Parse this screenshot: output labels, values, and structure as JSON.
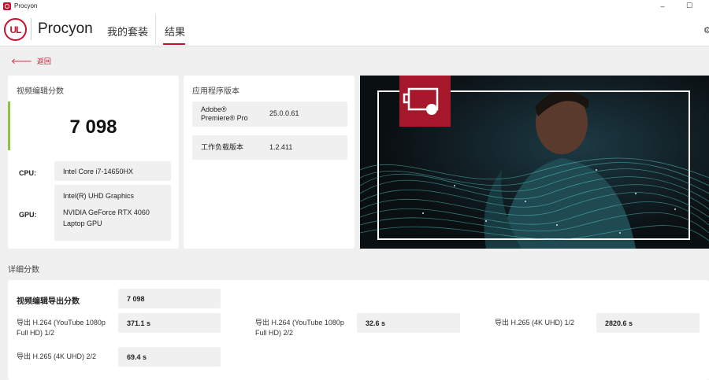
{
  "window": {
    "title": "Procyon",
    "minimize": "–",
    "maximize": "☐"
  },
  "header": {
    "logo_text": "UL",
    "brand": "Procyon",
    "tabs": [
      {
        "label": "我的套装"
      },
      {
        "label": "结果"
      }
    ],
    "right_icon": "gear-icon"
  },
  "back": {
    "label": "返回",
    "icon": "arrow-left-icon"
  },
  "score_panel": {
    "title": "视频编辑分数",
    "score": "7 098",
    "cpu_label": "CPU:",
    "cpu_value": "Intel Core i7-14650HX",
    "gpu_label": "GPU:",
    "gpu_values": [
      "Intel(R) UHD Graphics",
      "NVIDIA GeForce RTX 4060",
      "Laptop GPU"
    ]
  },
  "app_panel": {
    "title": "应用程序版本",
    "rows": [
      {
        "label_line1": "Adobe®",
        "label_line2": "Premiere® Pro",
        "value": "25.0.0.61"
      },
      {
        "label": "工作负载版本",
        "value": "1.2.411"
      }
    ]
  },
  "details": {
    "title": "详细分数",
    "export_score_label": "视频编辑导出分数",
    "export_score_value": "7 098",
    "items": [
      {
        "label_line1": "导出 H.264 (YouTube 1080p",
        "label_line2": "Full HD) 1/2",
        "value": "371.1 s"
      },
      {
        "label_line1": "导出 H.264 (YouTube 1080p",
        "label_line2": "Full HD) 2/2",
        "value": "32.6 s"
      },
      {
        "label_line1": "导出 H.265 (4K UHD) 1/2",
        "value": "2820.6 s"
      },
      {
        "label_line1": "导出 H.265 (4K UHD) 2/2",
        "value": "69.4 s"
      }
    ]
  },
  "colors": {
    "accent": "#c8102e",
    "score_bar": "#8cc63f",
    "panel": "#ffffff",
    "background": "#f0f0f0"
  }
}
